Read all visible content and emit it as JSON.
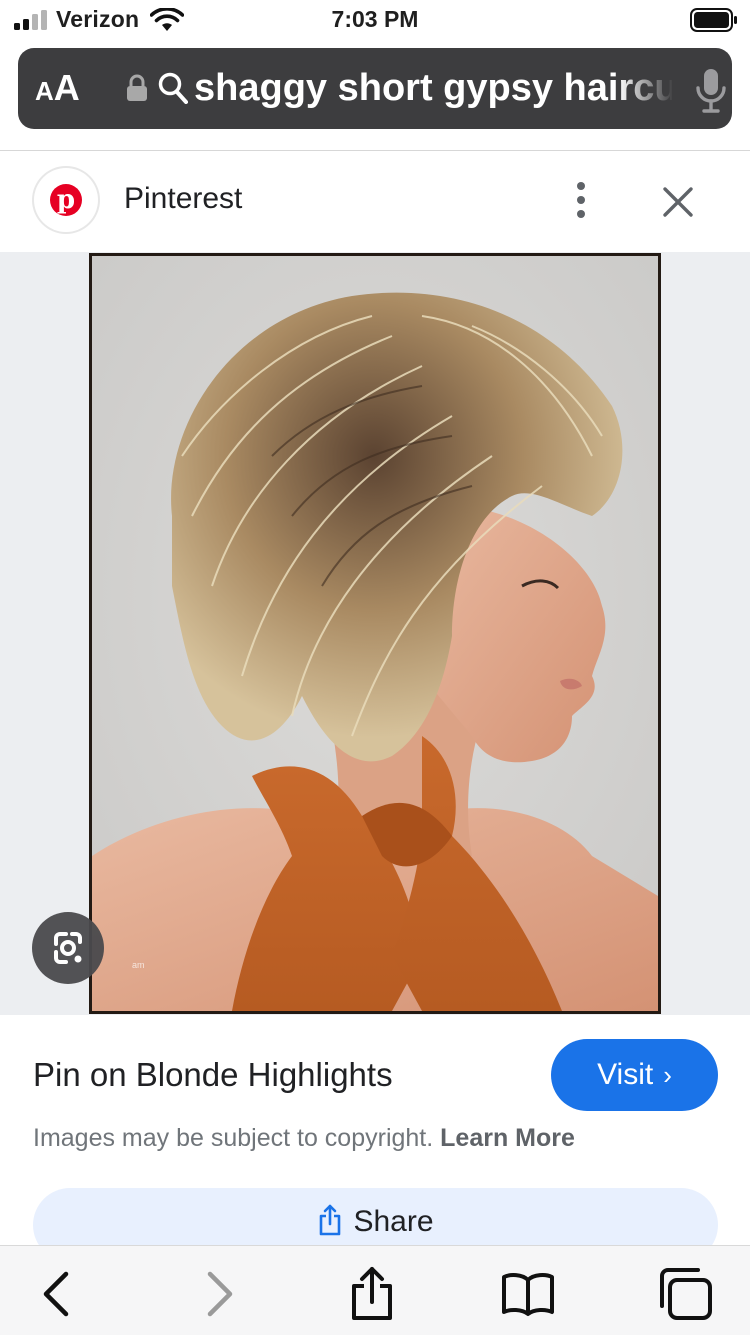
{
  "status_bar": {
    "carrier": "Verizon",
    "time": "7:03 PM"
  },
  "url_bar": {
    "text_size_label_small": "A",
    "text_size_label_large": "A",
    "query": "shaggy short gypsy haircut"
  },
  "source": {
    "name": "Pinterest",
    "logo_letter": "p"
  },
  "photo": {
    "watermark": "am"
  },
  "result": {
    "title": "Pin on Blonde Highlights",
    "visit_label": "Visit",
    "visit_chevron": "›",
    "copyright_text": "Images may be subject to copyright.",
    "learn_more_label": "Learn More",
    "share_label": "Share"
  },
  "colors": {
    "visit_blue": "#1a73e8",
    "pinterest_red": "#e60023",
    "url_bar_bg": "#3d3d3f"
  },
  "toolbar": {
    "items": [
      "back-icon",
      "forward-icon",
      "share-icon",
      "bookmarks-icon",
      "tabs-icon"
    ]
  }
}
